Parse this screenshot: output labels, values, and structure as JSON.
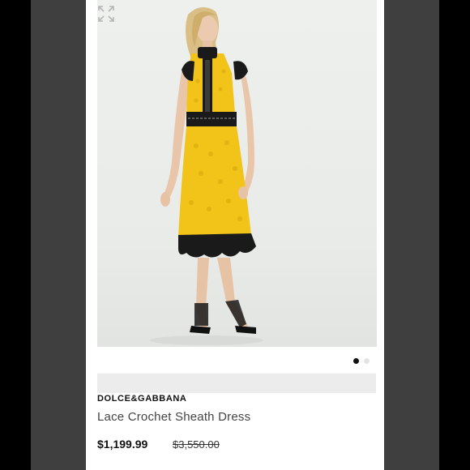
{
  "product": {
    "brand": "DOLCE&GABBANA",
    "title": "Lace Crochet Sheath Dress",
    "price": "$1,199.99",
    "original_price": "$3,550.00"
  },
  "gallery": {
    "image_alt": "Model wearing yellow lace dress with black crochet trim",
    "slide_count": 2,
    "active_slide": 1
  },
  "icons": {
    "expand": "expand-icon"
  },
  "colors": {
    "dress_yellow": "#f2c318",
    "trim_black": "#111111",
    "side_bars": "#3f3f3f",
    "panel_bg": "#ffffff"
  }
}
